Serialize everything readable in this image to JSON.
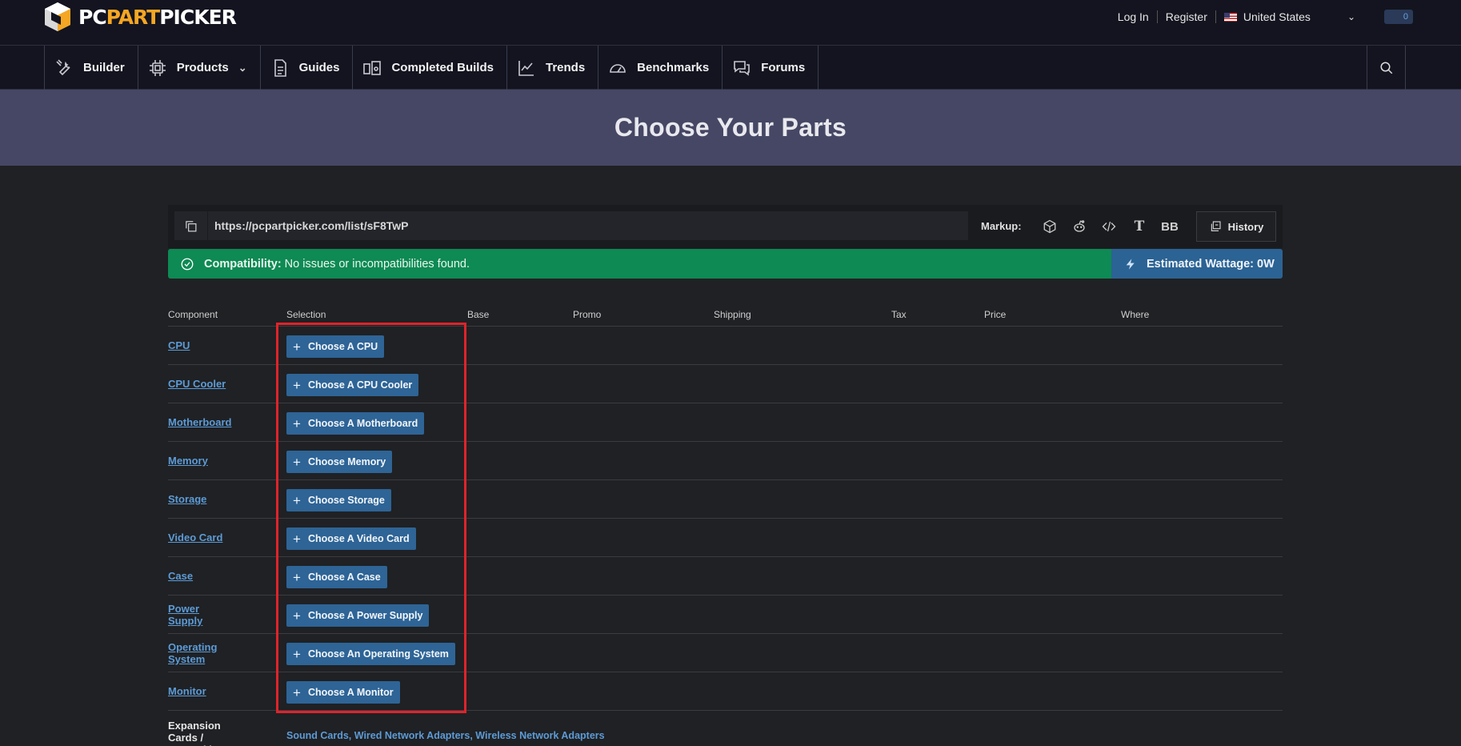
{
  "brand": {
    "logo_part1": "PC",
    "logo_part2": "PART",
    "logo_part3": "PICKER"
  },
  "top_links": {
    "login": "Log In",
    "register": "Register",
    "country": "United States",
    "cart_count": "0"
  },
  "nav": [
    {
      "label": "Builder",
      "icon": "wrench-icon"
    },
    {
      "label": "Products",
      "icon": "chip-icon"
    },
    {
      "label": "Guides",
      "icon": "document-icon"
    },
    {
      "label": "Completed Builds",
      "icon": "builds-icon"
    },
    {
      "label": "Trends",
      "icon": "trend-icon"
    },
    {
      "label": "Benchmarks",
      "icon": "gauge-icon"
    },
    {
      "label": "Forums",
      "icon": "chat-icon"
    }
  ],
  "page_title": "Choose Your Parts",
  "list": {
    "url": "https://pcpartpicker.com/list/sF8TwP",
    "markup_label": "Markup:",
    "text_icon": "T",
    "bb_icon": "BB",
    "history_label": "History"
  },
  "compat": {
    "label": "Compatibility:",
    "message": "No issues or incompatibilities found.",
    "wattage": "Estimated Wattage: 0W"
  },
  "columns": [
    "Component",
    "Selection",
    "Base",
    "Promo",
    "Shipping",
    "Tax",
    "Price",
    "Where"
  ],
  "rows": [
    {
      "component": "CPU",
      "button": "Choose A CPU"
    },
    {
      "component": "CPU Cooler",
      "button": "Choose A CPU Cooler"
    },
    {
      "component": "Motherboard",
      "button": "Choose A Motherboard"
    },
    {
      "component": "Memory",
      "button": "Choose Memory"
    },
    {
      "component": "Storage",
      "button": "Choose Storage"
    },
    {
      "component": "Video Card",
      "button": "Choose A Video Card"
    },
    {
      "component": "Case",
      "button": "Choose A Case"
    },
    {
      "component": "Power Supply",
      "button": "Choose A Power Supply"
    },
    {
      "component": "Operating System",
      "button": "Choose An Operating System"
    },
    {
      "component": "Monitor",
      "button": "Choose A Monitor"
    }
  ],
  "expansion": {
    "label": "Expansion Cards / Networking",
    "links": [
      "Sound Cards",
      "Wired Network Adapters",
      "Wireless Network Adapters"
    ]
  },
  "colors": {
    "accent_blue": "#2e6496",
    "compat_green": "#0e8a54",
    "wattage_blue": "#2b6394",
    "highlight_red": "#e0232b",
    "logo_orange": "#f5a623"
  }
}
